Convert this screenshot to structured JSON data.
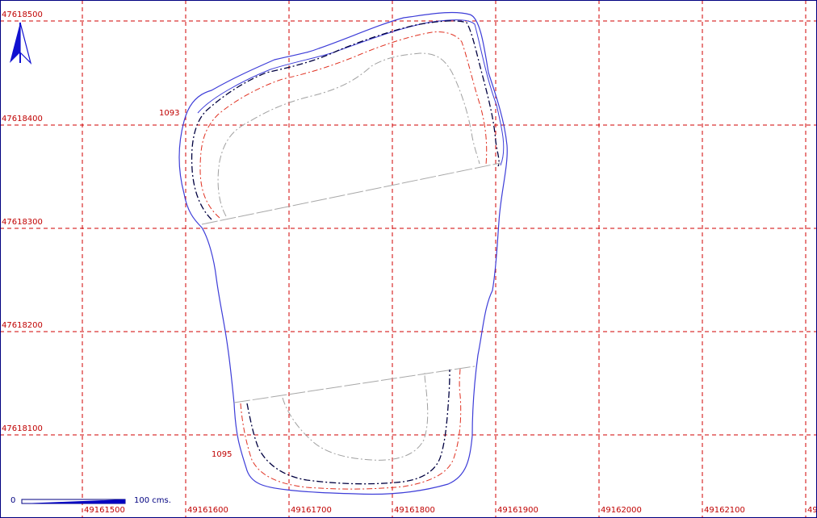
{
  "map": {
    "y_ticks": [
      "47618500",
      "47618400",
      "47618300",
      "47618200",
      "47618100"
    ],
    "x_ticks": [
      "49161500",
      "49161600",
      "49161700",
      "49161800",
      "49161900",
      "49162000",
      "49162100",
      "49"
    ],
    "contour_labels": [
      "1093",
      "1095"
    ],
    "scale_bar": {
      "start": "0",
      "end": "100 cms."
    },
    "colors": {
      "grid": "#d00000",
      "outline": "#3d3dd8",
      "contour_black": "#000040",
      "contour_red": "#e03020",
      "contour_gray": "#a0a0a0",
      "section_line": "#a8a8a8",
      "north_arrow": "#1010d0"
    },
    "icons": [
      "north-arrow-icon"
    ]
  }
}
